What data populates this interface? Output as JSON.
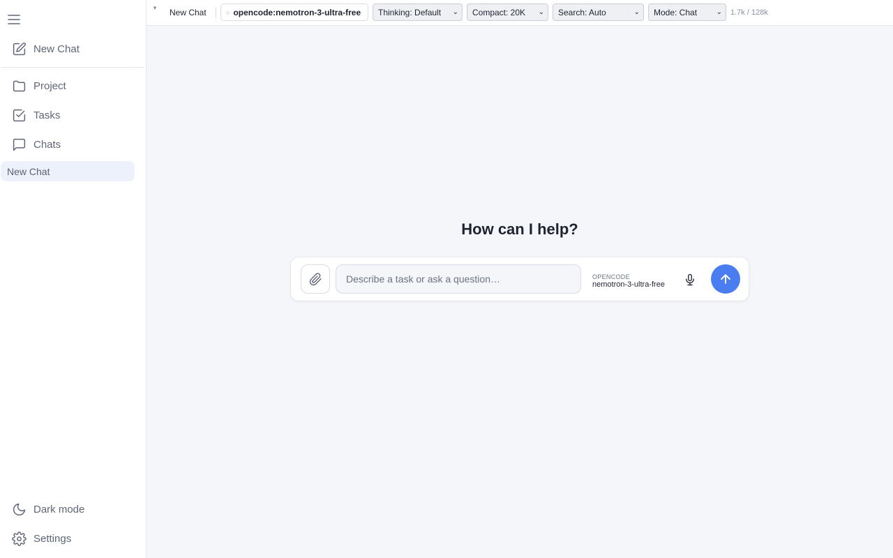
{
  "sidebar": {
    "new_chat": "New Chat",
    "items": [
      {
        "label": "Project",
        "icon": "folder-icon"
      },
      {
        "label": "Tasks",
        "icon": "check-square-icon"
      },
      {
        "label": "Chats",
        "icon": "chat-bubble-icon"
      }
    ],
    "chats": [
      "New Chat"
    ],
    "dark_mode": "Dark mode",
    "settings": "Settings"
  },
  "topbar": {
    "title": "New Chat",
    "model_indicator": "○",
    "model": "opencode:nemotron-3-ultra-free",
    "thinking": "Thinking: Default",
    "compact": "Compact: 20K",
    "search": "Search: Auto",
    "mode": "Mode: Chat",
    "tokens": "1.7k / 128k"
  },
  "main": {
    "heading": "How can I help?",
    "composer": {
      "placeholder": "Describe a task or ask a question…",
      "provider": "OPENCODE",
      "model": "nemotron-3-ultra-free"
    }
  },
  "colors": {
    "accent": "#4a7df0",
    "active_chat_bg": "#edf1fb",
    "background": "#f4f6fa"
  }
}
